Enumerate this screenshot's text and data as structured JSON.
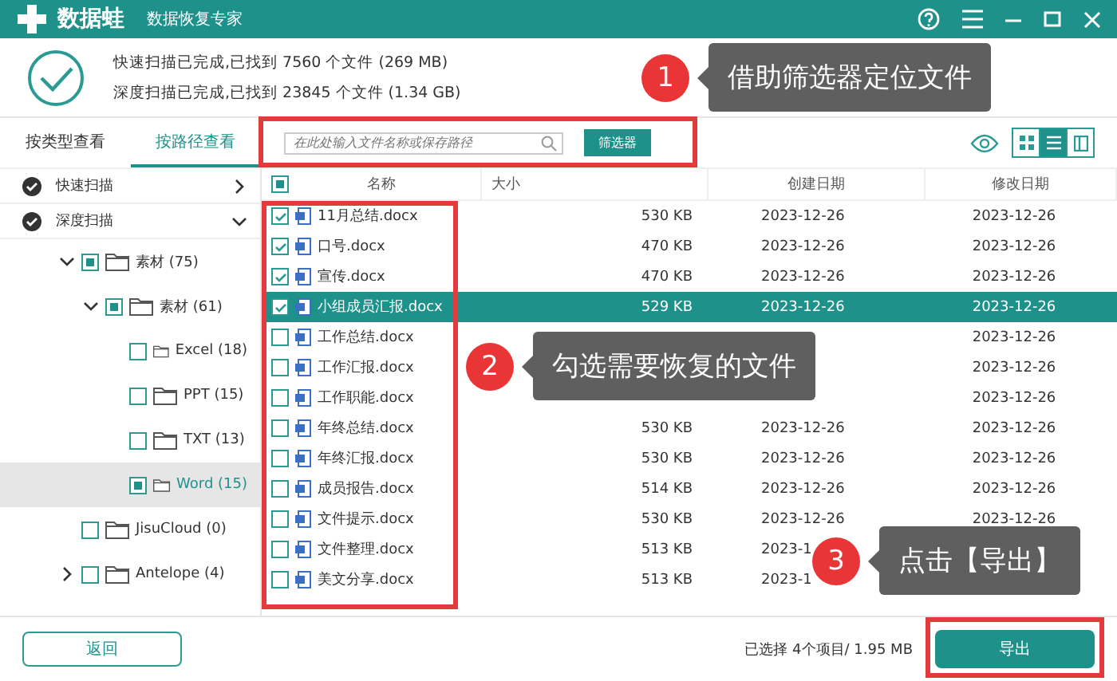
{
  "window": {
    "app_name": "数据蛙",
    "subtitle": "数据恢复专家"
  },
  "scan_summary": [
    "快速扫描已完成,已找到 7560 个文件 (269 MB)",
    "深度扫描已完成,已找到 23845 个文件 (1.34 GB)"
  ],
  "view_tabs": [
    {
      "label": "按类型查看",
      "selected": false
    },
    {
      "label": "按路径查看",
      "selected": true
    }
  ],
  "search": {
    "placeholder": "在此处输入文件名称或保存路径"
  },
  "filter_button": "筛选器",
  "view_modes": [
    {
      "kind": "grid",
      "selected": false
    },
    {
      "kind": "list",
      "selected": true
    },
    {
      "kind": "detail",
      "selected": false
    }
  ],
  "sidebar": [
    {
      "label": "快速扫描",
      "expanded": false
    },
    {
      "label": "深度扫描",
      "expanded": true,
      "children": [
        {
          "label": "素材 (75)",
          "partial": true,
          "expanded": true,
          "selected": false,
          "children": [
            {
              "label": "素材 (61)",
              "partial": true,
              "expanded": true,
              "selected": false,
              "children": [
                {
                  "label": "Excel (18)",
                  "partial": false,
                  "expanded": false,
                  "selected": false
                },
                {
                  "label": "PPT (15)",
                  "partial": false,
                  "expanded": false,
                  "selected": false
                },
                {
                  "label": "TXT (13)",
                  "partial": false,
                  "expanded": false,
                  "selected": false
                },
                {
                  "label": "Word (15)",
                  "partial": true,
                  "expanded": false,
                  "selected": true
                }
              ]
            }
          ]
        },
        {
          "label": "JisuCloud (0)",
          "partial": false,
          "expanded": false,
          "selected": false
        },
        {
          "label": "Antelope (4)",
          "partial": false,
          "expanded": false,
          "selected": false,
          "expandable": true
        }
      ]
    }
  ],
  "table": {
    "columns": [
      "名称",
      "大小",
      "创建日期",
      "修改日期"
    ],
    "select_all_partial": true,
    "rows": [
      {
        "name": "11月总结.docx",
        "size": "530 KB",
        "created": "2023-12-26",
        "modified": "2023-12-26",
        "checked": true,
        "selected": false
      },
      {
        "name": "口号.docx",
        "size": "470 KB",
        "created": "2023-12-26",
        "modified": "2023-12-26",
        "checked": true,
        "selected": false
      },
      {
        "name": "宣传.docx",
        "size": "470 KB",
        "created": "2023-12-26",
        "modified": "2023-12-26",
        "checked": true,
        "selected": false
      },
      {
        "name": "小组成员汇报.docx",
        "size": "529 KB",
        "created": "2023-12-26",
        "modified": "2023-12-26",
        "checked": true,
        "selected": true
      },
      {
        "name": "工作总结.docx",
        "modified": "2023-12-26",
        "checked": false,
        "selected": false
      },
      {
        "name": "工作汇报.docx",
        "modified": "2023-12-26",
        "checked": false,
        "selected": false
      },
      {
        "name": "工作职能.docx",
        "modified": "2023-12-26",
        "checked": false,
        "selected": false
      },
      {
        "name": "年终总结.docx",
        "size": "530 KB",
        "created": "2023-12-26",
        "modified": "2023-12-26",
        "checked": false,
        "selected": false
      },
      {
        "name": "年终汇报.docx",
        "size": "530 KB",
        "created": "2023-12-26",
        "modified": "2023-12-26",
        "checked": false,
        "selected": false
      },
      {
        "name": "成员报告.docx",
        "size": "514 KB",
        "created": "2023-12-26",
        "modified": "2023-12-26",
        "checked": false,
        "selected": false
      },
      {
        "name": "文件提示.docx",
        "size": "530 KB",
        "created": "2023-12-26",
        "modified": "2023-12-26",
        "checked": false,
        "selected": false
      },
      {
        "name": "文件整理.docx",
        "size": "513 KB",
        "created": "2023-1",
        "checked": false,
        "selected": false
      },
      {
        "name": "美文分享.docx",
        "size": "513 KB",
        "created": "2023-1",
        "checked": false,
        "selected": false
      }
    ]
  },
  "status": "已选择 4个项目/ 1.95 MB",
  "back_button": "返回",
  "export_button": "导出",
  "callouts": [
    {
      "number": "1",
      "text": "借助筛选器定位文件"
    },
    {
      "number": "2",
      "text": "勾选需要恢复的文件"
    },
    {
      "number": "3",
      "text": "点击【导出】"
    }
  ]
}
